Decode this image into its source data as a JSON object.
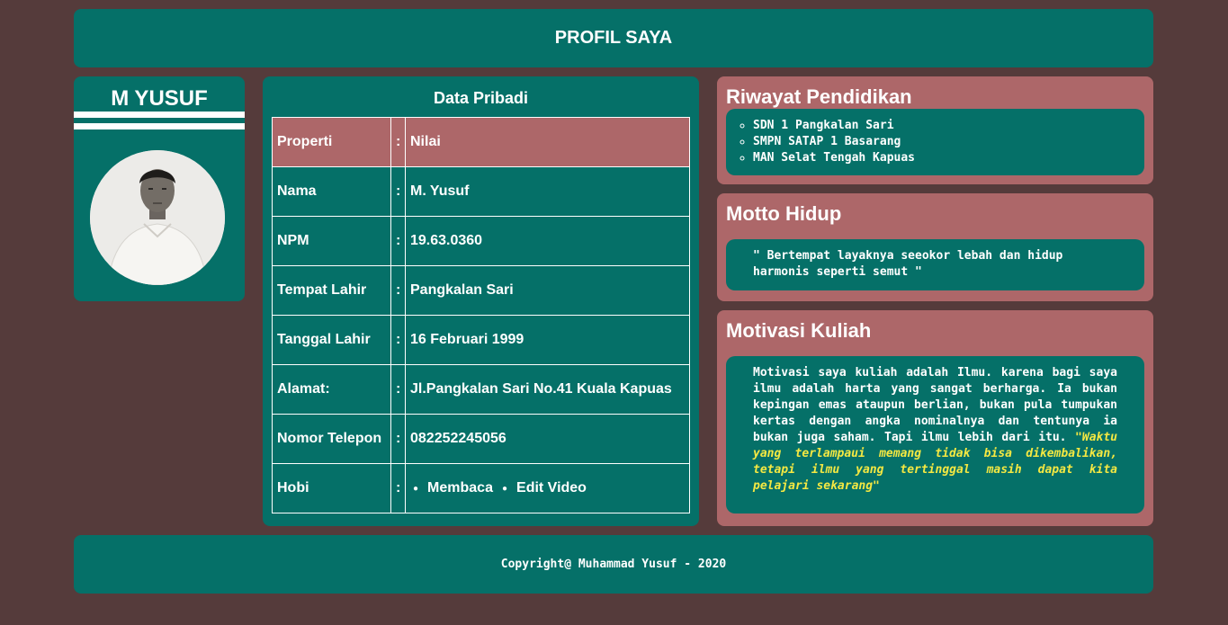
{
  "header": {
    "title": "PROFIL SAYA"
  },
  "profile": {
    "name": "M YUSUF",
    "photo_icon": "person-photo"
  },
  "data_pribadi": {
    "title": "Data Pribadi",
    "head": {
      "property": "Properti",
      "colon": ":",
      "value": "Nilai"
    },
    "rows": [
      {
        "property": "Nama",
        "colon": ":",
        "value": "M. Yusuf"
      },
      {
        "property": "NPM",
        "colon": ":",
        "value": "19.63.0360"
      },
      {
        "property": "Tempat Lahir",
        "colon": ":",
        "value": "Pangkalan Sari"
      },
      {
        "property": "Tanggal Lahir",
        "colon": ":",
        "value": "16 Februari 1999"
      },
      {
        "property": "Alamat:",
        "colon": ":",
        "value": "Jl.Pangkalan Sari No.41 Kuala Kapuas"
      },
      {
        "property": "Nomor Telepon",
        "colon": ":",
        "value": "082252245056"
      }
    ],
    "hobi": {
      "property": "Hobi",
      "colon": ":",
      "items": [
        "Membaca",
        "Edit Video"
      ]
    }
  },
  "pendidikan": {
    "title": "Riwayat Pendidikan",
    "items": [
      "SDN 1 Pangkalan Sari",
      "SMPN SATAP 1 Basarang",
      "MAN Selat Tengah Kapuas"
    ]
  },
  "motto": {
    "title": "Motto Hidup",
    "text": "\" Bertempat layaknya seeokor lebah dan hidup harmonis seperti semut \""
  },
  "motivasi": {
    "title": "Motivasi Kuliah",
    "text": "Motivasi saya kuliah adalah Ilmu. karena bagi saya ilmu adalah harta yang sangat berharga. Ia bukan kepingan emas ataupun berlian, bukan pula tumpukan kertas dengan angka nominalnya dan tentunya ia bukan juga saham. Tapi ilmu lebih dari itu.",
    "quote": "\"Waktu yang terlampaui memang tidak bisa dikembalikan, tetapi ilmu yang tertinggal masih dapat kita pelajari sekarang\""
  },
  "footer": {
    "text": "Copyright@ Muhammad Yusuf - 2020"
  },
  "colors": {
    "background": "#553b3b",
    "teal": "#057068",
    "rose": "#ad6769",
    "quote": "#f4e842"
  }
}
